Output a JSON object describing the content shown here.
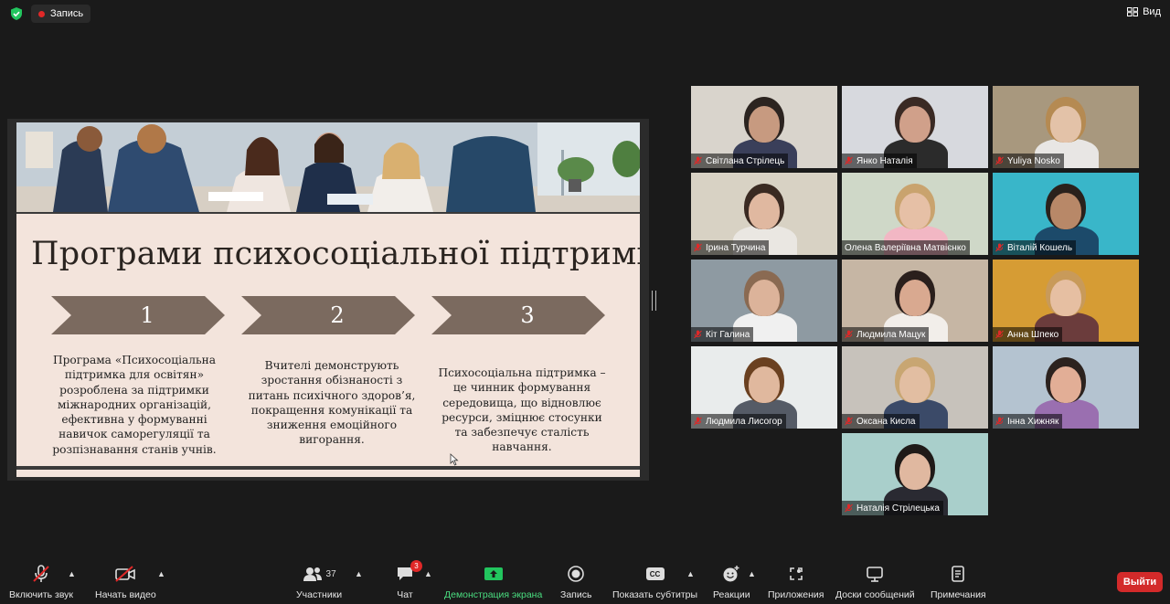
{
  "topbar": {
    "record_label": "Запись",
    "view_label": "Вид"
  },
  "slide": {
    "title": "Програми психосоціальної підтримки",
    "chevron_color": "#7b6a5f",
    "steps": [
      {
        "number": "1",
        "text": "Програма «Психосоціальна підтримка для освітян» розроблена за підтримки міжнародних організацій, ефективна у формуванні навичок саморегуляції та розпізнавання станів учнів."
      },
      {
        "number": "2",
        "text": "Вчителі демонструють зростання обізнаності з питань психічного здоров’я, покращення комунікації та зниження емоційного вигорання."
      },
      {
        "number": "3",
        "text": "Психосоціальна підтримка – це чинник формування середовища, що відновлює ресурси, зміцнює стосунки та забезпечує сталість навчання."
      }
    ]
  },
  "participants": [
    {
      "name": "Світлана Стрілець",
      "muted": true,
      "active": false,
      "bg": "#d9d4cc",
      "skin": "#c79a80",
      "hair": "#2c2420",
      "top": "#3a3f5a"
    },
    {
      "name": "Янко Наталія",
      "muted": true,
      "active": false,
      "bg": "#d7d9de",
      "skin": "#d0a08a",
      "hair": "#3a2a24",
      "top": "#2b2b2b"
    },
    {
      "name": "Yuliya Nosko",
      "muted": true,
      "active": false,
      "bg": "#a8987e",
      "skin": "#e3c2a8",
      "hair": "#b58a52",
      "top": "#e8e6e4"
    },
    {
      "name": "Ірина Турчина",
      "muted": true,
      "active": false,
      "bg": "#d8d2c4",
      "skin": "#e0b8a0",
      "hair": "#3a2a22",
      "top": "#eae7e2"
    },
    {
      "name": "Олена Валеріївна Матвієнко",
      "muted": false,
      "active": true,
      "bg": "#cfd8c8",
      "skin": "#e6c0a6",
      "hair": "#c9a36e",
      "top": "#f2b7c4"
    },
    {
      "name": "Віталій Кошель",
      "muted": true,
      "active": false,
      "bg": "#39b6c9",
      "skin": "#b88868",
      "hair": "#2a211c",
      "top": "#1c4a6a"
    },
    {
      "name": "Кіт Галина",
      "muted": true,
      "active": false,
      "bg": "#8e9aa2",
      "skin": "#dcb39a",
      "hair": "#8a6a52",
      "top": "#f0f0f0"
    },
    {
      "name": "Людмила Мацук",
      "muted": true,
      "active": false,
      "bg": "#c6b6a4",
      "skin": "#d9a990",
      "hair": "#2a1f1c",
      "top": "#f2eeea"
    },
    {
      "name": "Анна Шпеко",
      "muted": true,
      "active": false,
      "bg": "#d69c34",
      "skin": "#e6bfa2",
      "hair": "#c89a5a",
      "top": "#6b3c3c"
    },
    {
      "name": "Людмила Лисогор",
      "muted": true,
      "active": false,
      "bg": "#e9ecec",
      "skin": "#e0b89e",
      "hair": "#6a4020",
      "top": "#555b66"
    },
    {
      "name": "Оксана Кисла",
      "muted": true,
      "active": false,
      "bg": "#c7c2bb",
      "skin": "#e2bea2",
      "hair": "#c8a672",
      "top": "#3b4a68"
    },
    {
      "name": "Інна Хижняк",
      "muted": true,
      "active": false,
      "bg": "#b4c3d0",
      "skin": "#e2ae96",
      "hair": "#2c221e",
      "top": "#9a6fb0"
    },
    {
      "name": "Наталія Стрілецька",
      "muted": true,
      "active": false,
      "bg": "#a9cfcb",
      "skin": "#e0b8a0",
      "hair": "#1f1a18",
      "top": "#2a2a32"
    }
  ],
  "toolbar": {
    "audio": "Включить звук",
    "video": "Начать видео",
    "participants": "Участники",
    "participants_count": "37",
    "chat": "Чат",
    "chat_badge": "3",
    "share": "Демонстрация экрана",
    "record": "Запись",
    "captions": "Показать субтитры",
    "captions_icon_text": "CC",
    "reactions": "Реакции",
    "apps": "Приложения",
    "whiteboards": "Доски сообщений",
    "notes": "Примечания",
    "leave": "Выйти"
  }
}
